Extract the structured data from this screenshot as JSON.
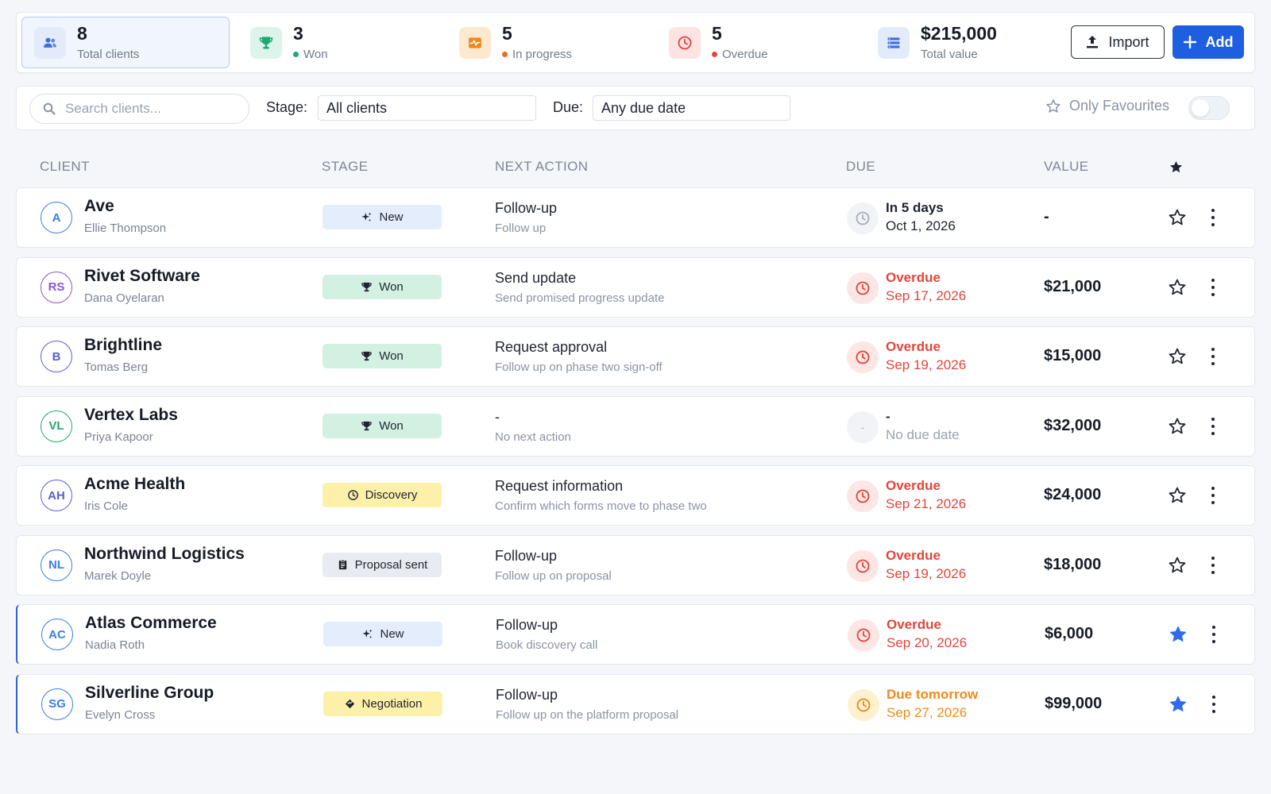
{
  "stats": [
    {
      "value": "8",
      "label": "Total clients",
      "icon": "users-icon",
      "color": "#3b6fd8",
      "bg": "#e3ebfa"
    },
    {
      "value": "3",
      "label": "Won",
      "icon": "trophy-icon",
      "color": "#1fa971",
      "bg": "#dcf4ea",
      "dot": "#1fa971"
    },
    {
      "value": "5",
      "label": "In progress",
      "icon": "activity-icon",
      "color": "#ef8a1a",
      "bg": "#fde9cf",
      "dot": "#ef6a1a"
    },
    {
      "value": "5",
      "label": "Overdue",
      "icon": "clock-icon",
      "color": "#e0463c",
      "bg": "#fde3e1",
      "dot": "#e0463c"
    },
    {
      "value": "$215,000",
      "label": "Total value",
      "icon": "list-icon",
      "color": "#3b6fd8",
      "bg": "#e3ebfa"
    }
  ],
  "toolbar": {
    "import_label": "Import",
    "add_label": "Add"
  },
  "filters": {
    "search_placeholder": "Search clients...",
    "stage_label": "Stage:",
    "stage_value": "All clients",
    "due_label": "Due:",
    "due_value": "Any due date",
    "favourites_label": "Only Favourites",
    "favourites_on": false
  },
  "columns": {
    "client": "CLIENT",
    "stage": "STAGE",
    "next_action": "NEXT ACTION",
    "due": "DUE",
    "value": "VALUE"
  },
  "rows": [
    {
      "initials": "A",
      "name": "Ave",
      "contact": "Ellie Thompson",
      "stage": "New",
      "stage_icon": "sparkle-icon",
      "action": "Follow-up",
      "action_sub": "Follow up",
      "due_status": "In 5 days",
      "due_date": "Oct 1, 2026",
      "due_kind": "future",
      "value": "-",
      "favourite": false,
      "avatar_color": "#3b7de0"
    },
    {
      "initials": "RS",
      "name": "Rivet Software",
      "contact": "Dana Oyelaran",
      "stage": "Won",
      "stage_icon": "trophy-icon",
      "action": "Send update",
      "action_sub": "Send promised progress update",
      "due_status": "Overdue",
      "due_date": "Sep 17, 2026",
      "due_kind": "overdue",
      "value": "$21,000",
      "favourite": false,
      "avatar_color": "#8a55d6"
    },
    {
      "initials": "B",
      "name": "Brightline",
      "contact": "Tomas Berg",
      "stage": "Won",
      "stage_icon": "trophy-icon",
      "action": "Request approval",
      "action_sub": "Follow up on phase two sign-off",
      "due_status": "Overdue",
      "due_date": "Sep 19, 2026",
      "due_kind": "overdue",
      "value": "$15,000",
      "favourite": false,
      "avatar_color": "#5a5fd0"
    },
    {
      "initials": "VL",
      "name": "Vertex Labs",
      "contact": "Priya Kapoor",
      "stage": "Won",
      "stage_icon": "trophy-icon",
      "action": "-",
      "action_sub": "No next action",
      "due_status": "-",
      "due_date": "No due date",
      "due_kind": "none",
      "value": "$32,000",
      "favourite": false,
      "avatar_color": "#1faa6e"
    },
    {
      "initials": "AH",
      "name": "Acme Health",
      "contact": "Iris Cole",
      "stage": "Discovery",
      "stage_icon": "clock-icon",
      "action": "Request information",
      "action_sub": "Confirm which forms move to phase two",
      "due_status": "Overdue",
      "due_date": "Sep 21, 2026",
      "due_kind": "overdue",
      "value": "$24,000",
      "favourite": false,
      "avatar_color": "#5a5fd0"
    },
    {
      "initials": "NL",
      "name": "Northwind Logistics",
      "contact": "Marek Doyle",
      "stage": "Proposal sent",
      "stage_icon": "document-icon",
      "action": "Follow-up",
      "action_sub": "Follow up on proposal",
      "due_status": "Overdue",
      "due_date": "Sep 19, 2026",
      "due_kind": "overdue",
      "value": "$18,000",
      "favourite": false,
      "avatar_color": "#3b7de0"
    },
    {
      "initials": "AC",
      "name": "Atlas Commerce",
      "contact": "Nadia Roth",
      "stage": "New",
      "stage_icon": "sparkle-icon",
      "action": "Follow-up",
      "action_sub": "Book discovery call",
      "due_status": "Overdue",
      "due_date": "Sep 20, 2026",
      "due_kind": "overdue",
      "value": "$6,000",
      "favourite": true,
      "avatar_color": "#3b7de0"
    },
    {
      "initials": "SG",
      "name": "Silverline Group",
      "contact": "Evelyn Cross",
      "stage": "Negotiation",
      "stage_icon": "handshake-icon",
      "action": "Follow-up",
      "action_sub": "Follow up on the platform proposal",
      "due_status": "Due tomorrow",
      "due_date": "Sep 27, 2026",
      "due_kind": "soon",
      "value": "$99,000",
      "favourite": true,
      "avatar_color": "#3b7de0"
    }
  ],
  "stage_colors": {
    "New": "#e4edfb",
    "Won": "#d3f1e3",
    "Discovery": "#fdf0a8",
    "Proposal sent": "#e8ebf1",
    "Negotiation": "#fdf0a8"
  },
  "due_colors": {
    "overdue": "#e0463c",
    "soon": "#ef8a1a",
    "future": "#1f2430",
    "none": "#9aa2b0"
  }
}
